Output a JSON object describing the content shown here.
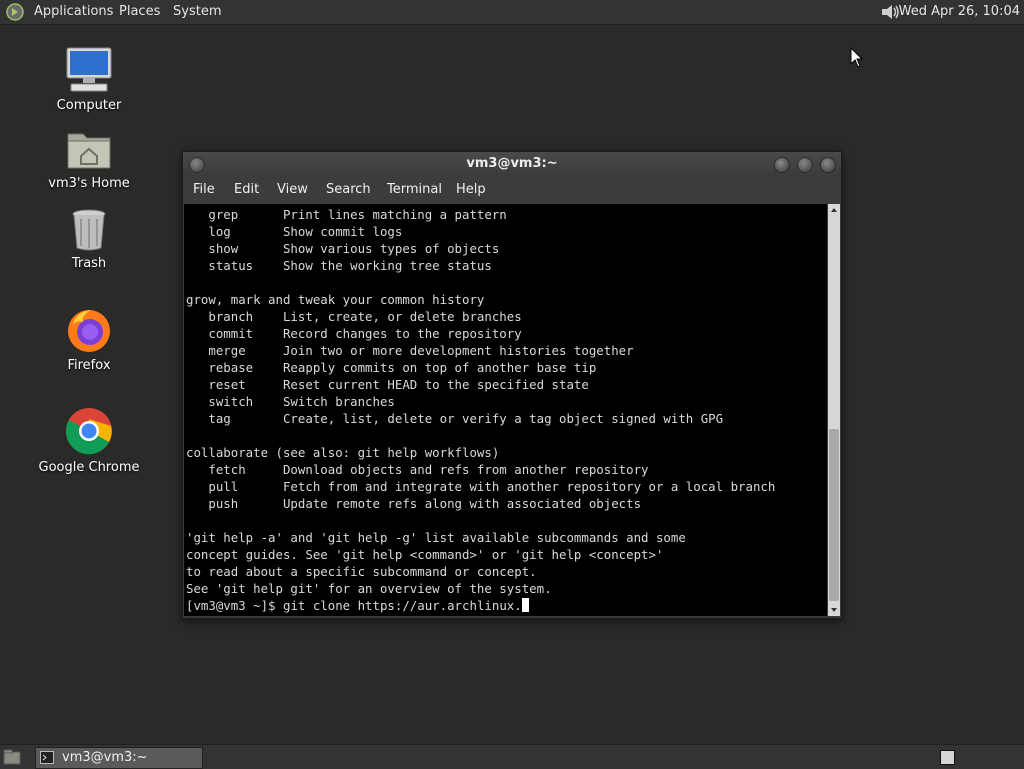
{
  "top_panel": {
    "menus": [
      "Applications",
      "Places",
      "System"
    ],
    "clock": "Wed Apr 26, 10:04"
  },
  "desktop": {
    "icons": [
      {
        "label": "Computer",
        "icon": "computer-icon"
      },
      {
        "label": "vm3's Home",
        "icon": "home-folder-icon"
      },
      {
        "label": "Trash",
        "icon": "trash-icon"
      },
      {
        "label": "Firefox",
        "icon": "firefox-icon"
      },
      {
        "label": "Google Chrome",
        "icon": "chrome-icon"
      }
    ]
  },
  "window": {
    "title": "vm3@vm3:~",
    "menu": [
      "File",
      "Edit",
      "View",
      "Search",
      "Terminal",
      "Help"
    ],
    "lines": [
      "   grep      Print lines matching a pattern",
      "   log       Show commit logs",
      "   show      Show various types of objects",
      "   status    Show the working tree status",
      "",
      "grow, mark and tweak your common history",
      "   branch    List, create, or delete branches",
      "   commit    Record changes to the repository",
      "   merge     Join two or more development histories together",
      "   rebase    Reapply commits on top of another base tip",
      "   reset     Reset current HEAD to the specified state",
      "   switch    Switch branches",
      "   tag       Create, list, delete or verify a tag object signed with GPG",
      "",
      "collaborate (see also: git help workflows)",
      "   fetch     Download objects and refs from another repository",
      "   pull      Fetch from and integrate with another repository or a local branch",
      "   push      Update remote refs along with associated objects",
      "",
      "'git help -a' and 'git help -g' list available subcommands and some",
      "concept guides. See 'git help <command>' or 'git help <concept>'",
      "to read about a specific subcommand or concept.",
      "See 'git help git' for an overview of the system."
    ],
    "prompt": "[vm3@vm3 ~]$ ",
    "command": "git clone https://aur.archlinux."
  },
  "taskbar": {
    "task_label": "vm3@vm3:~"
  }
}
